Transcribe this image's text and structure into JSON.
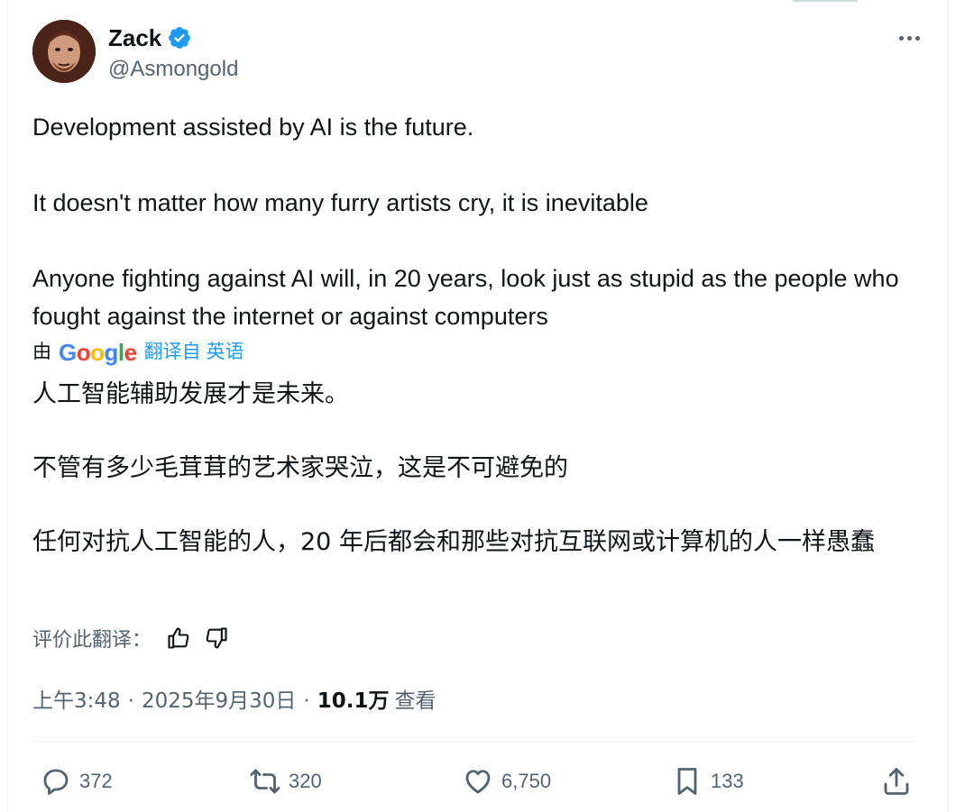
{
  "author": {
    "name": "Zack",
    "handle": "@Asmongold",
    "verified": true
  },
  "tweet": {
    "paragraphs": [
      "Development assisted by AI is the future.",
      "It doesn't matter how many furry artists cry, it is inevitable",
      "Anyone fighting against AI will, in 20 years, look just as stupid as the people who fought against the internet or against computers"
    ]
  },
  "translation": {
    "by_label": "由",
    "provider": "Google",
    "from_label": "翻译自 英语",
    "paragraphs": [
      "人工智能辅助发展才是未来。",
      "不管有多少毛茸茸的艺术家哭泣，这是不可避免的",
      "任何对抗人工智能的人，20 年后都会和那些对抗互联网或计算机的人一样愚蠢"
    ],
    "rate_label": "评价此翻译："
  },
  "meta": {
    "time": "上午3:48",
    "date": "2025年9月30日",
    "separator": "·",
    "views_count": "10.1万",
    "views_label": "查看"
  },
  "actions": {
    "replies": "372",
    "reposts": "320",
    "likes": "6,750",
    "bookmarks": "133"
  },
  "colors": {
    "text": "#0f1419",
    "secondary": "#536471",
    "accent": "#1d9bf0"
  },
  "icons": [
    "verified-badge-icon",
    "more-icon",
    "thumbs-up-icon",
    "thumbs-down-icon",
    "reply-icon",
    "repost-icon",
    "like-icon",
    "bookmark-icon",
    "share-icon"
  ]
}
